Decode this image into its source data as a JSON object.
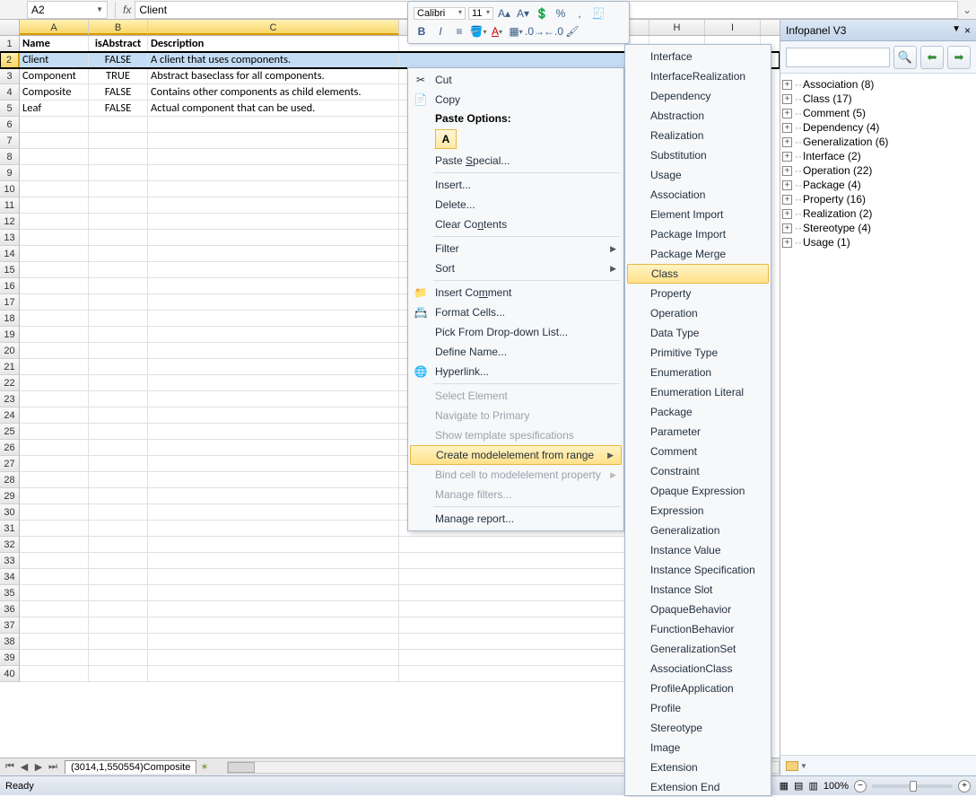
{
  "formula_bar": {
    "cell_ref": "A2",
    "fx_label": "fx",
    "value": "Client"
  },
  "columns": [
    "A",
    "B",
    "C",
    "H",
    "I"
  ],
  "headers": {
    "A": "Name",
    "B": "isAbstract",
    "C": "Description"
  },
  "rows": [
    {
      "n": 1,
      "A": "Name",
      "B": "isAbstract",
      "C": "Description",
      "header": true
    },
    {
      "n": 2,
      "A": "Client",
      "B": "FALSE",
      "C": "A client that uses components.",
      "selected": true
    },
    {
      "n": 3,
      "A": "Component",
      "B": "TRUE",
      "C": "Abstract baseclass for all components."
    },
    {
      "n": 4,
      "A": "Composite",
      "B": "FALSE",
      "C": "Contains other components as child elements."
    },
    {
      "n": 5,
      "A": "Leaf",
      "B": "FALSE",
      "C": "Actual component that can be used."
    }
  ],
  "sheet_tab": "(3014,1,550554)Composite",
  "status": {
    "ready": "Ready",
    "zoom": "100%"
  },
  "mini_toolbar": {
    "font": "Calibri",
    "size": "11",
    "percent": "%"
  },
  "context_menu": {
    "cut": "Cut",
    "copy": "Copy",
    "paste_options": "Paste Options:",
    "paste_special": "Paste Special...",
    "insert": "Insert...",
    "delete": "Delete...",
    "clear": "Clear Contents",
    "filter": "Filter",
    "sort": "Sort",
    "insert_comment": "Insert Comment",
    "format_cells": "Format Cells...",
    "pick_list": "Pick From Drop-down List...",
    "define_name": "Define Name...",
    "hyperlink": "Hyperlink...",
    "select_element": "Select Element",
    "navigate_primary": "Navigate to Primary",
    "show_template": "Show template spesifications",
    "create_model": "Create modelelement from range",
    "bind_cell": "Bind cell to modelelement property",
    "manage_filters": "Manage filters...",
    "manage_report": "Manage report..."
  },
  "submenu": [
    "Interface",
    "InterfaceRealization",
    "Dependency",
    "Abstraction",
    "Realization",
    "Substitution",
    "Usage",
    "Association",
    "Element Import",
    "Package Import",
    "Package Merge",
    "Class",
    "Property",
    "Operation",
    "Data Type",
    "Primitive Type",
    "Enumeration",
    "Enumeration Literal",
    "Package",
    "Parameter",
    "Comment",
    "Constraint",
    "Opaque Expression",
    "Expression",
    "Generalization",
    "Instance Value",
    "Instance Specification",
    "Instance Slot",
    "OpaqueBehavior",
    "FunctionBehavior",
    "GeneralizationSet",
    "AssociationClass",
    "ProfileApplication",
    "Profile",
    "Stereotype",
    "Image",
    "Extension",
    "Extension End"
  ],
  "submenu_highlight": "Class",
  "infopanel": {
    "title": "Infopanel V3",
    "tree": [
      "Association (8)",
      "Class (17)",
      "Comment (5)",
      "Dependency (4)",
      "Generalization (6)",
      "Interface (2)",
      "Operation (22)",
      "Package (4)",
      "Property (16)",
      "Realization (2)",
      "Stereotype (4)",
      "Usage (1)"
    ]
  }
}
